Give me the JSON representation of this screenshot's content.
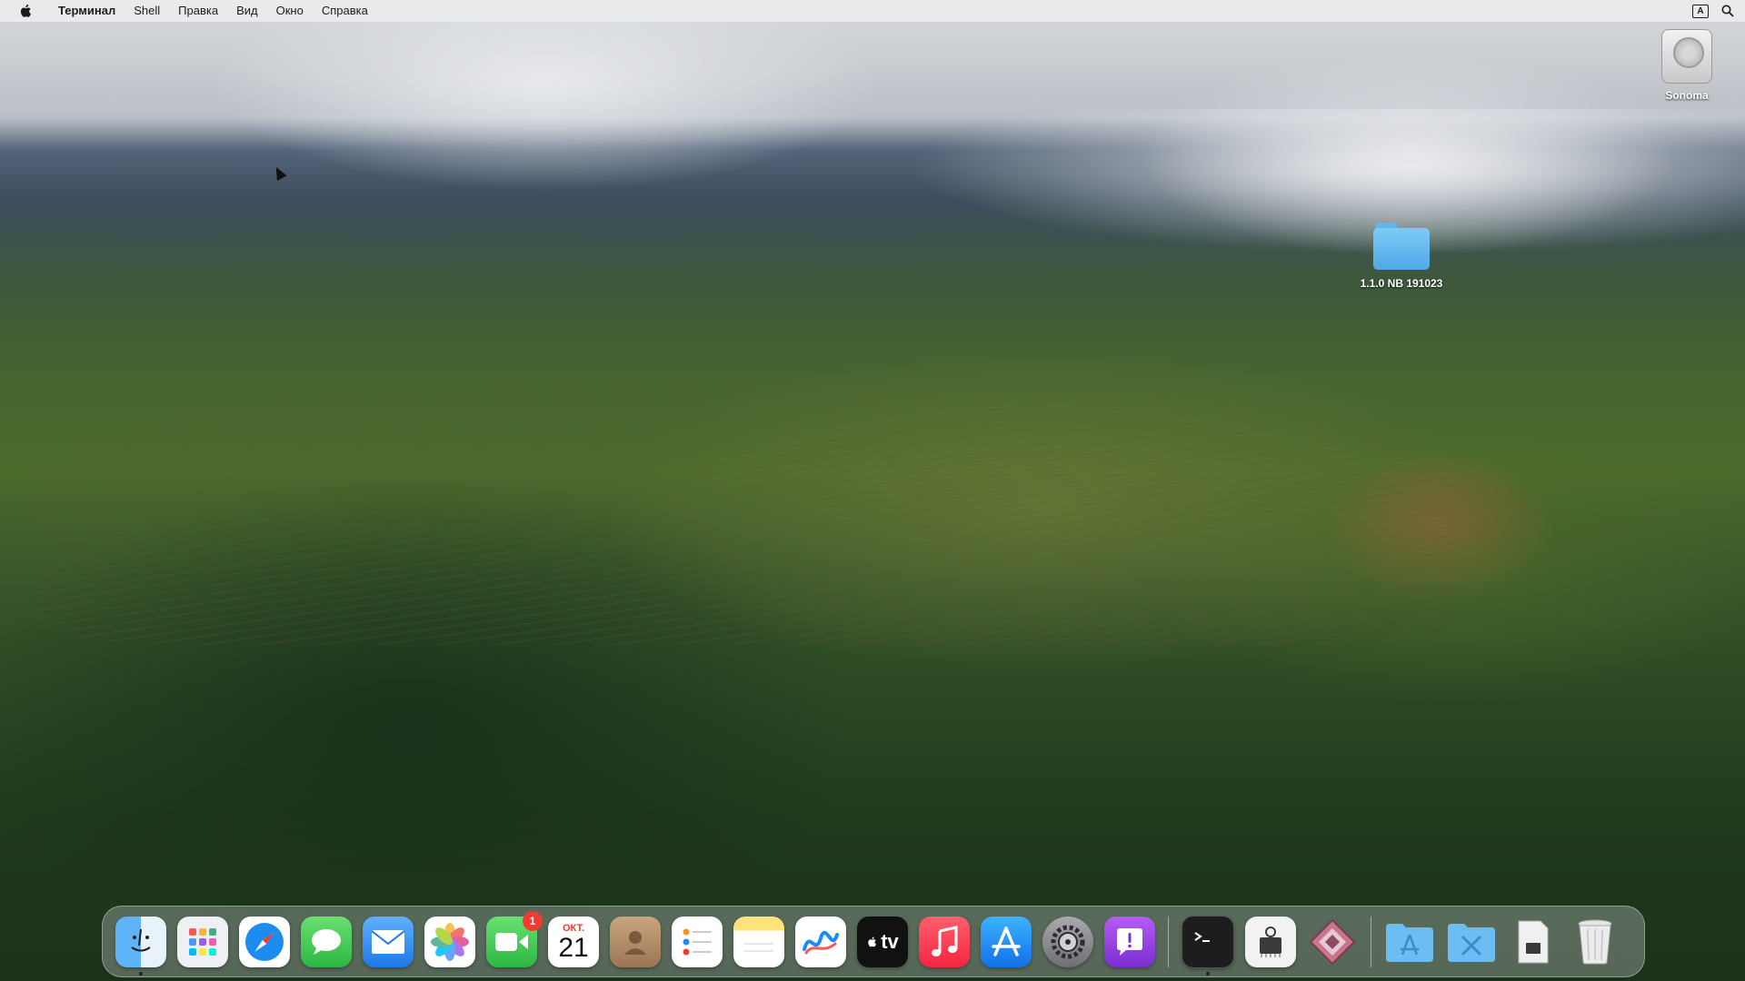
{
  "menubar": {
    "app_name": "Терминал",
    "menus": [
      "Shell",
      "Правка",
      "Вид",
      "Окно",
      "Справка"
    ],
    "input_source": "A"
  },
  "desktop": {
    "disk_label": "Sonoma",
    "folder_label": "1.1.0 NB 191023"
  },
  "dock": {
    "apps": [
      {
        "name": "Finder",
        "icon": "finder-icon",
        "color": "#2f8ff2"
      },
      {
        "name": "Launchpad",
        "icon": "launchpad-icon",
        "color": "#e9ecf1"
      },
      {
        "name": "Safari",
        "icon": "safari-icon",
        "color": "#1d8cf0"
      },
      {
        "name": "Messages",
        "icon": "messages-icon",
        "color": "#34c759"
      },
      {
        "name": "Mail",
        "icon": "mail-icon",
        "color": "#2c8ef0"
      },
      {
        "name": "Photos",
        "icon": "photos-icon",
        "color": "#ffffff"
      },
      {
        "name": "FaceTime",
        "icon": "facetime-icon",
        "color": "#34c759",
        "badge": "1"
      },
      {
        "name": "Calendar",
        "icon": "calendar-icon",
        "month": "ОКТ.",
        "day": "21"
      },
      {
        "name": "Contacts",
        "icon": "contacts-icon",
        "color": "#b08d68"
      },
      {
        "name": "Reminders",
        "icon": "reminders-icon",
        "color": "#ffffff"
      },
      {
        "name": "Notes",
        "icon": "notes-icon",
        "color": "#ffe27a"
      },
      {
        "name": "Freeform",
        "icon": "freeform-icon",
        "color": "#ffffff"
      },
      {
        "name": "TV",
        "icon": "tv-icon",
        "color": "#111111",
        "label": "tv"
      },
      {
        "name": "Music",
        "icon": "music-icon",
        "color": "#fa3d55"
      },
      {
        "name": "App Store",
        "icon": "app-store-icon",
        "color": "#1a8cf2"
      },
      {
        "name": "System Settings",
        "icon": "settings-icon",
        "color": "#8e8e93"
      },
      {
        "name": "Feedback Assistant",
        "icon": "feedback-icon",
        "color": "#8f3ee0"
      }
    ],
    "apps2": [
      {
        "name": "Terminal",
        "icon": "terminal-icon",
        "color": "#1d1d1f",
        "running": true
      },
      {
        "name": "System Information",
        "icon": "system-info-icon",
        "color": "#e5e5e5"
      },
      {
        "name": "Script Editor",
        "icon": "script-icon",
        "color": "#c9758e"
      }
    ],
    "stacks": [
      {
        "name": "Applications",
        "icon": "applications-folder-icon",
        "color": "#6cbdf2"
      },
      {
        "name": "Utilities",
        "icon": "utilities-folder-icon",
        "color": "#6cbdf2"
      },
      {
        "name": "Document",
        "icon": "document-icon",
        "color": "#e8e8e8"
      },
      {
        "name": "Trash",
        "icon": "trash-icon",
        "color": "#dcdcdc"
      }
    ]
  }
}
